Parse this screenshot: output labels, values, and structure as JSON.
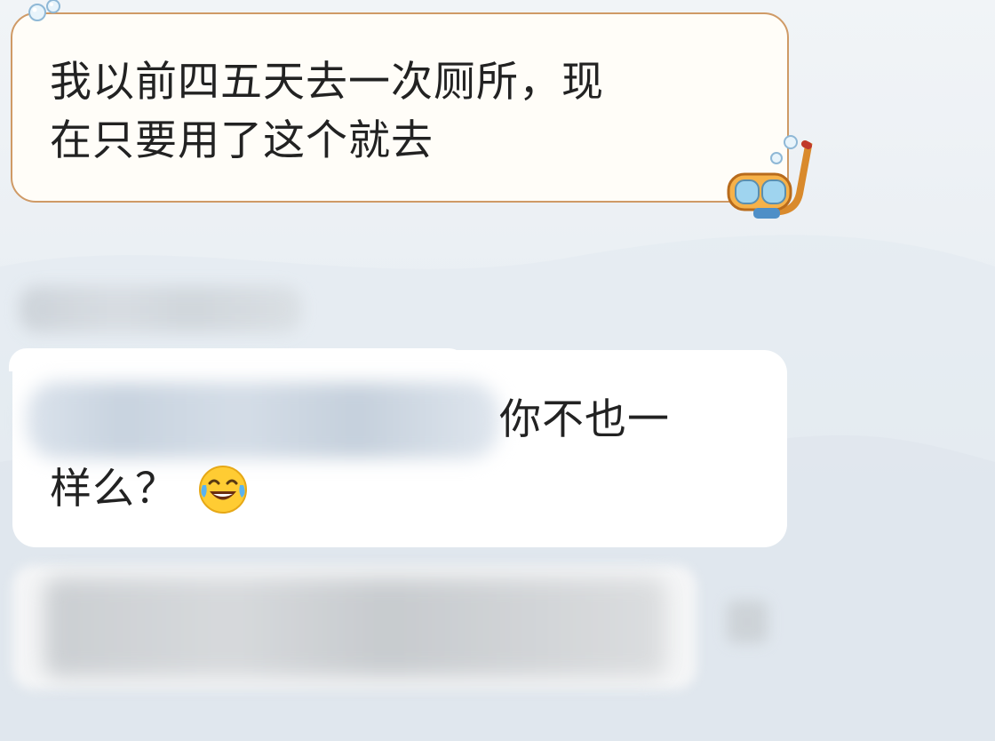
{
  "chat": {
    "messages": [
      {
        "id": "msg-1",
        "line1": "我以前四五天去一次厕所，现",
        "line2": "在只要用了这个就去"
      },
      {
        "id": "msg-2",
        "line1": "你不也一",
        "line2": "样么？",
        "emoji": "laughing-tears-emoji"
      }
    ]
  },
  "colors": {
    "bubble_themed_bg": "#fffdf8",
    "bubble_themed_border": "#cf9a66",
    "bubble_plain_bg": "#ffffff",
    "text": "#222222",
    "background": "#e6ecf1"
  },
  "icons": {
    "decor_bubbles": "water-bubbles-icon",
    "decor_snorkel": "snorkel-mask-icon",
    "emoji": "laughing-tears-emoji"
  }
}
